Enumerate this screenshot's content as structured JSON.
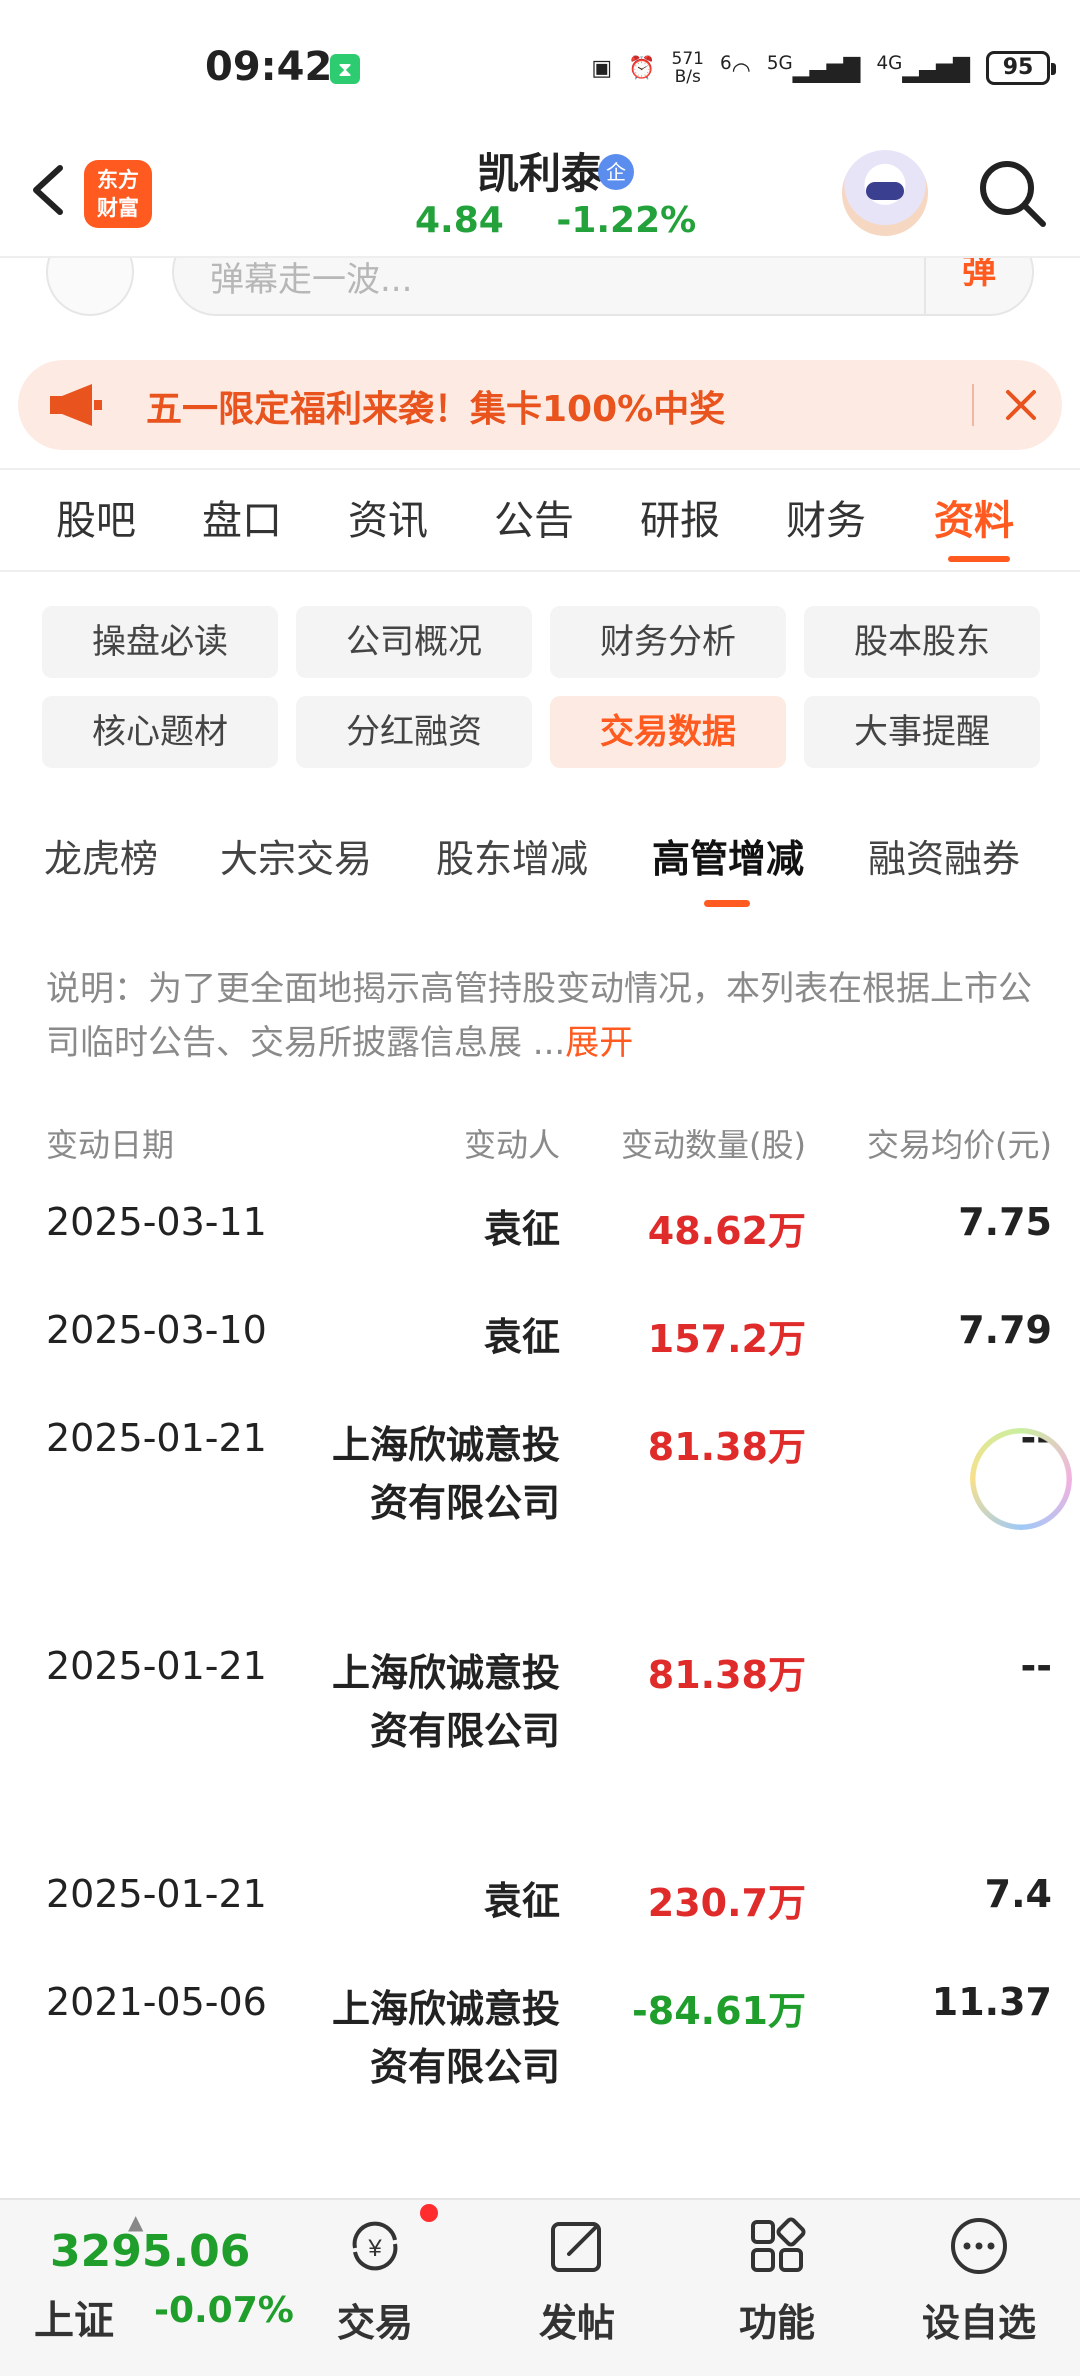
{
  "status_bar": {
    "time": "09:42",
    "net_speed_top": "571",
    "net_speed_bottom": "B/s",
    "signal_5g": "5G",
    "signal_4g": "4G",
    "wifi_label": "6",
    "battery": "95"
  },
  "header": {
    "app_logo_line1": "东方",
    "app_logo_line2": "财富",
    "stock_name": "凯利泰",
    "stock_badge": "企",
    "price": "4.84",
    "change_pct": "-1.22%"
  },
  "danmu": {
    "placeholder": "弹幕走一波...",
    "send_label": "弹"
  },
  "promo": {
    "text": "五一限定福利来袭！集卡100%中奖"
  },
  "main_tabs": [
    {
      "label": "股吧"
    },
    {
      "label": "盘口"
    },
    {
      "label": "资讯"
    },
    {
      "label": "公告"
    },
    {
      "label": "研报"
    },
    {
      "label": "财务"
    },
    {
      "label": "资料"
    }
  ],
  "chips": [
    {
      "label": "操盘必读"
    },
    {
      "label": "公司概况"
    },
    {
      "label": "财务分析"
    },
    {
      "label": "股本股东"
    },
    {
      "label": "核心题材"
    },
    {
      "label": "分红融资"
    },
    {
      "label": "交易数据"
    },
    {
      "label": "大事提醒"
    }
  ],
  "sub_tabs": [
    {
      "label": "龙虎榜"
    },
    {
      "label": "大宗交易"
    },
    {
      "label": "股东增减"
    },
    {
      "label": "高管增减"
    },
    {
      "label": "融资融券"
    }
  ],
  "description": {
    "text": "说明：为了更全面地揭示高管持股变动情况，本列表在根据上市公司临时公告、交易所披露信息展 ...",
    "expand_label": "展开"
  },
  "table": {
    "headers": {
      "date": "变动日期",
      "person": "变动人",
      "qty": "变动数量(股)",
      "price": "交易均价(元)"
    },
    "rows": [
      {
        "date": "2025-03-11",
        "person": "袁征",
        "qty": "48.62万",
        "price": "7.75"
      },
      {
        "date": "2025-03-10",
        "person": "袁征",
        "qty": "157.2万",
        "price": "7.79"
      },
      {
        "date": "2025-01-21",
        "person": "上海欣诚意投资有限公司",
        "qty": "81.38万",
        "price": "--"
      },
      {
        "date": "2025-01-21",
        "person": "上海欣诚意投资有限公司",
        "qty": "81.38万",
        "price": "--"
      },
      {
        "date": "2025-01-21",
        "person": "袁征",
        "qty": "230.7万",
        "price": "7.4"
      },
      {
        "date": "2021-05-06",
        "person": "上海欣诚意投资有限公司",
        "qty": "-84.61万",
        "price": "11.37"
      }
    ]
  },
  "bottom_bar": {
    "index_value": "3295.06",
    "index_name": "上证",
    "index_change": "-0.07%",
    "nav": [
      {
        "label": "交易"
      },
      {
        "label": "发帖"
      },
      {
        "label": "功能"
      },
      {
        "label": "设自选"
      }
    ]
  },
  "colors": {
    "accent": "#ff5a1f",
    "up": "#e02b2b",
    "down": "#1f9e2c"
  }
}
